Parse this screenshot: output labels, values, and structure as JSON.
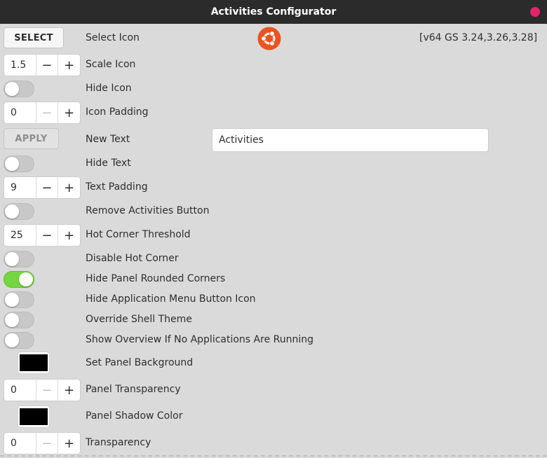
{
  "window": {
    "title": "Activities Configurator"
  },
  "rows": {
    "select_icon": {
      "button": "SELECT",
      "label": "Select Icon"
    },
    "version": "[v64 GS 3.24,3.26,3.28]",
    "scale_icon": {
      "value": "1.5",
      "minus": "−",
      "plus": "+",
      "label": "Scale Icon"
    },
    "hide_icon": {
      "label": "Hide Icon",
      "on": false
    },
    "icon_padding": {
      "value": "0",
      "minus": "−",
      "plus": "+",
      "label": "Icon Padding"
    },
    "new_text": {
      "button": "APPLY",
      "label": "New Text",
      "entry_value": "Activities"
    },
    "hide_text": {
      "label": "Hide Text",
      "on": false
    },
    "text_padding": {
      "value": "9",
      "minus": "−",
      "plus": "+",
      "label": "Text Padding"
    },
    "remove_activities": {
      "label": "Remove Activities Button",
      "on": false
    },
    "hot_corner_threshold": {
      "value": "25",
      "minus": "−",
      "plus": "+",
      "label": "Hot Corner Threshold"
    },
    "disable_hot_corner": {
      "label": "Disable Hot Corner",
      "on": false
    },
    "hide_rounded_corners": {
      "label": "Hide Panel Rounded Corners",
      "on": true
    },
    "hide_app_menu_icon": {
      "label": "Hide Application Menu Button Icon",
      "on": false
    },
    "override_theme": {
      "label": "Override Shell Theme",
      "on": false
    },
    "show_overview": {
      "label": "Show Overview If No Applications Are Running",
      "on": false
    },
    "panel_background": {
      "label": "Set Panel Background",
      "color": "#000000"
    },
    "panel_transparency": {
      "value": "0",
      "minus": "−",
      "plus": "+",
      "label": "Panel Transparency"
    },
    "panel_shadow": {
      "label": "Panel Shadow Color",
      "color": "#000000"
    },
    "transparency": {
      "value": "0",
      "minus": "−",
      "plus": "+",
      "label": "Transparency"
    }
  },
  "colors": {
    "titlebar": "#2b2b2b",
    "close": "#e6226c",
    "toggle_on": "#75d642",
    "ubuntu": "#e95420"
  }
}
